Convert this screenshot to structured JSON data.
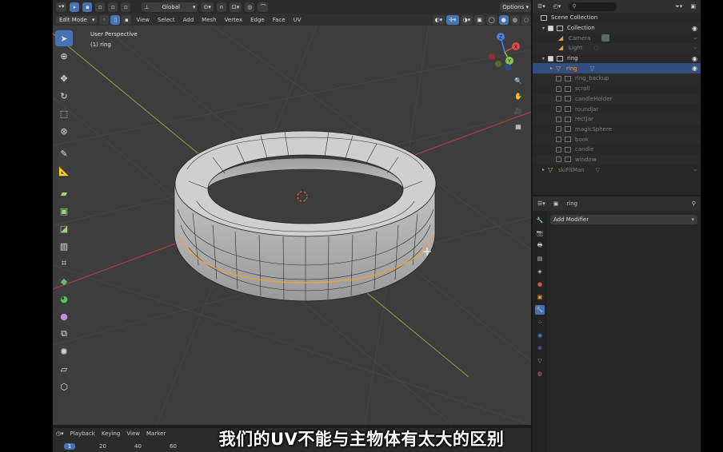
{
  "header": {
    "orientation": "Global",
    "options_label": "Options",
    "search_placeholder": ""
  },
  "menubar": {
    "mode": "Edit Mode",
    "items": [
      "View",
      "Select",
      "Add",
      "Mesh",
      "Vertex",
      "Edge",
      "Face",
      "UV"
    ]
  },
  "viewport": {
    "perspective_label": "User Perspective",
    "object_label": "(1) ring",
    "gizmo": {
      "x": "X",
      "y": "Y",
      "z": "Z"
    }
  },
  "timeline": {
    "menu": [
      "Playback",
      "Keying",
      "View",
      "Marker"
    ],
    "current_frame": "1",
    "frames": [
      "20",
      "40",
      "60"
    ]
  },
  "outliner": {
    "scene_collection": "Scene Collection",
    "rows": [
      {
        "label": "Collection",
        "type": "collection",
        "checked": true,
        "dim": false
      },
      {
        "label": "Camera",
        "type": "object",
        "checked": false,
        "dim": true
      },
      {
        "label": "Light",
        "type": "object",
        "checked": false,
        "dim": true
      },
      {
        "label": "ring",
        "type": "collection",
        "checked": true,
        "dim": false
      },
      {
        "label": "ring",
        "type": "object",
        "checked": false,
        "dim": false,
        "selected": true
      },
      {
        "label": "ring_backup",
        "type": "collection",
        "checked": false,
        "dim": true
      },
      {
        "label": "scroll",
        "type": "collection",
        "checked": false,
        "dim": true
      },
      {
        "label": "candleHolder",
        "type": "collection",
        "checked": false,
        "dim": true
      },
      {
        "label": "roundJar",
        "type": "collection",
        "checked": false,
        "dim": true
      },
      {
        "label": "rectJar",
        "type": "collection",
        "checked": false,
        "dim": true
      },
      {
        "label": "magicSphere",
        "type": "collection",
        "checked": false,
        "dim": true
      },
      {
        "label": "book",
        "type": "collection",
        "checked": false,
        "dim": true
      },
      {
        "label": "candle",
        "type": "collection",
        "checked": false,
        "dim": true
      },
      {
        "label": "window",
        "type": "collection",
        "checked": false,
        "dim": true
      },
      {
        "label": "skiFitMan",
        "type": "object",
        "checked": false,
        "dim": true
      }
    ]
  },
  "properties": {
    "object_name": "ring",
    "add_modifier_label": "Add Modifier"
  },
  "subtitle": "我们的UV不能与主物体有太大的区别",
  "colors": {
    "accent": "#4772b3",
    "viewport_bg": "#3d3d3d",
    "x_axis": "#c2394b",
    "y_axis": "#8aa63d",
    "edge_select": "#f0a030"
  }
}
